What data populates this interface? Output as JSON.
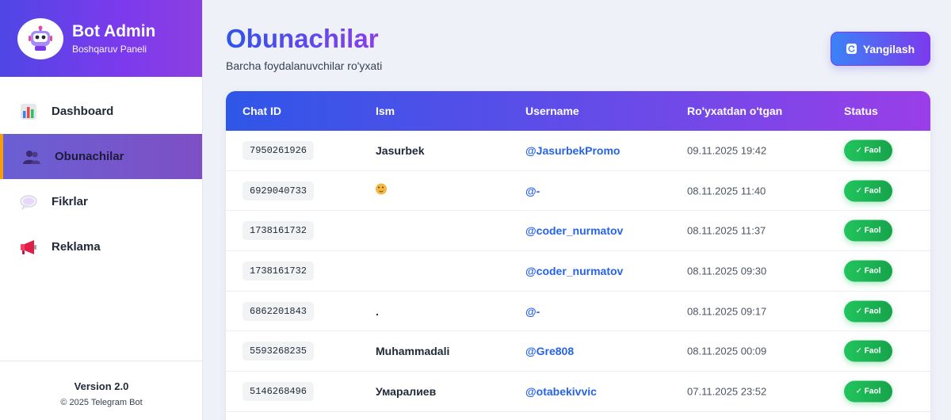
{
  "brand": {
    "title": "Bot Admin",
    "subtitle": "Boshqaruv Paneli",
    "logo_icon": "robot-icon"
  },
  "nav": [
    {
      "label": "Dashboard",
      "icon": "bar-chart-icon",
      "active": false
    },
    {
      "label": "Obunachilar",
      "icon": "users-icon",
      "active": true
    },
    {
      "label": "Fikrlar",
      "icon": "speech-bubble-icon",
      "active": false
    },
    {
      "label": "Reklama",
      "icon": "megaphone-icon",
      "active": false
    }
  ],
  "footer": {
    "version": "Version 2.0",
    "copyright": "© 2025 Telegram Bot"
  },
  "page": {
    "title": "Obunachilar",
    "subtitle": "Barcha foydalanuvchilar ro'yxati",
    "refresh_label": "Yangilash"
  },
  "table": {
    "headers": {
      "chat_id": "Chat ID",
      "name": "Ism",
      "username": "Username",
      "registered": "Ro'yxatdan o'tgan",
      "status": "Status"
    },
    "rows": [
      {
        "chat_id": "7950261926",
        "name": "Jasurbek",
        "username": "@JasurbekPromo",
        "date": "09.11.2025 19:42",
        "status": "✓ Faol"
      },
      {
        "chat_id": "6929040733",
        "name": "",
        "name_icon": "smiley-emoji-icon",
        "username": "@-",
        "date": "08.11.2025 11:40",
        "status": "✓ Faol"
      },
      {
        "chat_id": "1738161732",
        "name": "",
        "username": "@coder_nurmatov",
        "date": "08.11.2025 11:37",
        "status": "✓ Faol"
      },
      {
        "chat_id": "1738161732",
        "name": "",
        "username": "@coder_nurmatov",
        "date": "08.11.2025 09:30",
        "status": "✓ Faol"
      },
      {
        "chat_id": "6862201843",
        "name": ".",
        "username": "@-",
        "date": "08.11.2025 09:17",
        "status": "✓ Faol"
      },
      {
        "chat_id": "5593268235",
        "name": "Muhammadali",
        "username": "@Gre808",
        "date": "08.11.2025 00:09",
        "status": "✓ Faol"
      },
      {
        "chat_id": "5146268496",
        "name": "Умаралиев",
        "username": "@otabekivvic",
        "date": "07.11.2025 23:52",
        "status": "✓ Faol"
      }
    ]
  },
  "colors": {
    "accent_start": "#2f56e8",
    "accent_end": "#9a3ee8",
    "status_green": "#22c55e",
    "link_blue": "#2563eb"
  }
}
